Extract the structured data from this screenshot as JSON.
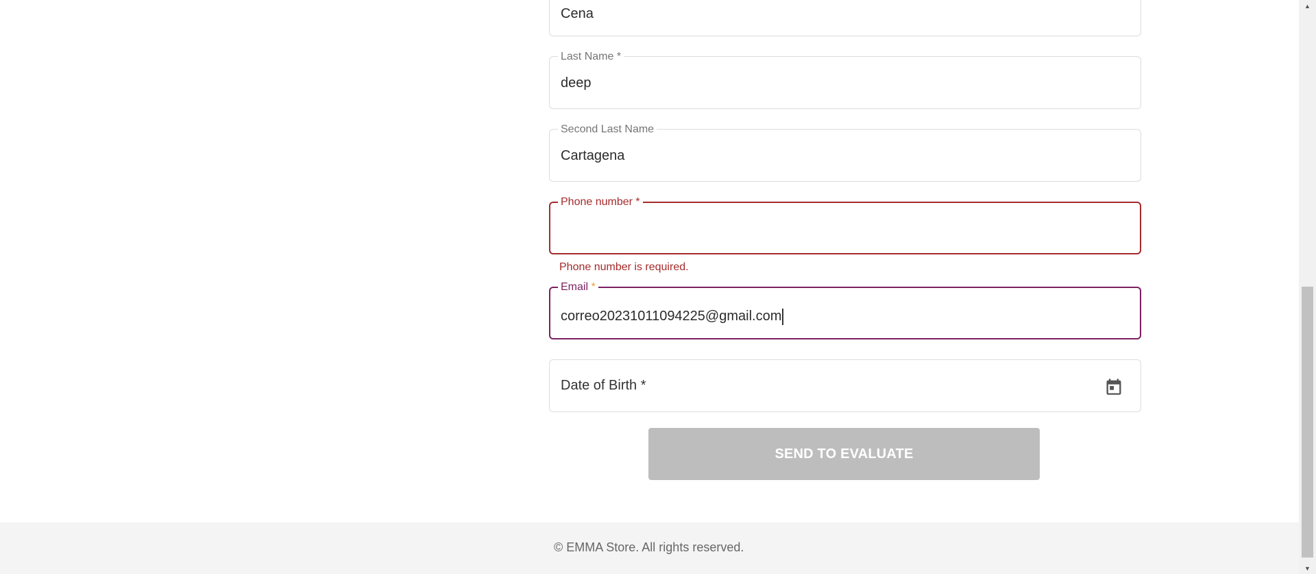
{
  "form": {
    "first_name": {
      "value": "Cena"
    },
    "last_name": {
      "label": "Last Name *",
      "value": "deep"
    },
    "second_last_name": {
      "label": "Second Last Name",
      "value": "Cartagena"
    },
    "phone": {
      "label": "Phone number *",
      "value": "",
      "error": "Phone number is required."
    },
    "email": {
      "label": "Email",
      "required_mark": "*",
      "value": "correo20231011094225@gmail.com"
    },
    "date_of_birth": {
      "placeholder": "Date of Birth *",
      "icon": "calendar-icon"
    },
    "submit_label": "SEND TO EVALUATE"
  },
  "footer": {
    "text": "© EMMA Store. All rights reserved."
  },
  "colors": {
    "error": "#a52a2a",
    "focus": "#7b1f5f",
    "button_disabled": "#bdbdbd",
    "footer_bg": "#f4f4f4"
  }
}
